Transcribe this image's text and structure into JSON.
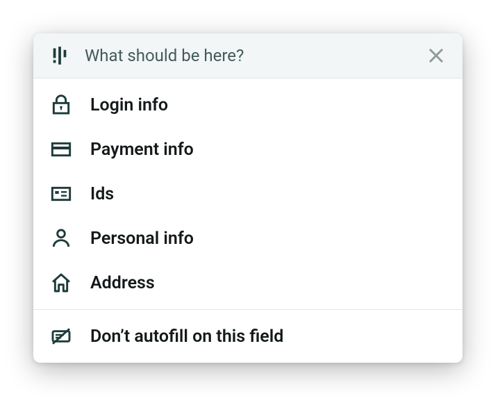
{
  "header": {
    "title": "What should be here?"
  },
  "items": [
    {
      "icon": "lock",
      "label": "Login info"
    },
    {
      "icon": "card",
      "label": "Payment info"
    },
    {
      "icon": "id",
      "label": "Ids"
    },
    {
      "icon": "person",
      "label": "Personal info"
    },
    {
      "icon": "home",
      "label": "Address"
    }
  ],
  "footer": {
    "icon": "no-autofill",
    "label": "Don’t autofill on this field"
  }
}
